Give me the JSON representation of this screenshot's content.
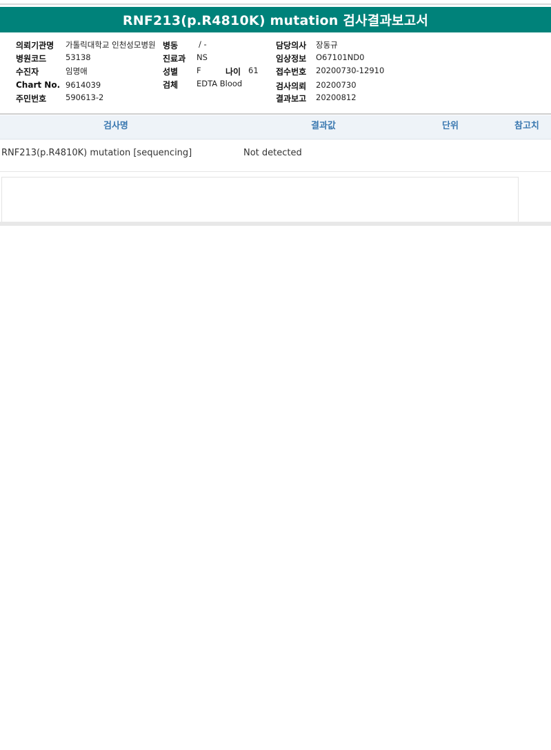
{
  "report": {
    "title": "RNF213(p.R4810K) mutation 검사결과보고서"
  },
  "patient_info": {
    "requesting_institution": {
      "label": "의뢰기관명",
      "value": "가톨릭대학교 인천성모병원"
    },
    "ward": {
      "label": "병동",
      "value": "/ -"
    },
    "attending_physician": {
      "label": "담당의사",
      "value": "장동규"
    },
    "hospital_code": {
      "label": "병원코드",
      "value": "53138"
    },
    "department": {
      "label": "진료과",
      "value": "NS"
    },
    "clinical_info": {
      "label": "임상정보",
      "value": "O67101ND0"
    },
    "examinee": {
      "label": "수진자",
      "value": "임명애"
    },
    "sex": {
      "label": "성별",
      "value": "F"
    },
    "age": {
      "label": "나이",
      "value": "61"
    },
    "receipt_number": {
      "label": "접수번호",
      "value": "20200730-12910"
    },
    "chart_no": {
      "label": "Chart No.",
      "value": "9614039"
    },
    "specimen": {
      "label": "검체",
      "value": "EDTA Blood"
    },
    "test_request": {
      "label": "검사의뢰",
      "value": "20200730"
    },
    "resident_number": {
      "label": "주민번호",
      "value": "590613-2"
    },
    "result_report": {
      "label": "결과보고",
      "value": "20200812"
    }
  },
  "results_table": {
    "headers": {
      "test_name": "검사명",
      "result_value": "결과값",
      "unit": "단위",
      "reference": "참고치"
    },
    "rows": [
      {
        "test_name": "RNF213(p.R4810K) mutation [sequencing]",
        "result_value": "Not detected",
        "unit": "",
        "reference": ""
      }
    ]
  },
  "colors": {
    "title_bar": "#00827a",
    "header_text": "#3a78b0",
    "header_bg": "#eef3f8"
  }
}
